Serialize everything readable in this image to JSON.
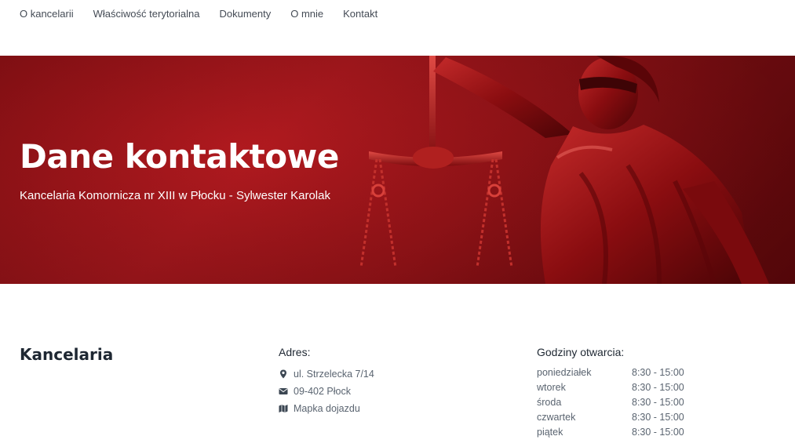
{
  "nav": {
    "items": [
      {
        "label": "O kancelarii"
      },
      {
        "label": "Właściwość terytorialna"
      },
      {
        "label": "Dokumenty"
      },
      {
        "label": "O mnie"
      },
      {
        "label": "Kontakt"
      }
    ]
  },
  "hero": {
    "title": "Dane kontaktowe",
    "subtitle": "Kancelaria Komornicza nr XIII w Płocku - Sylwester Karolak",
    "background_color": "#a3151b"
  },
  "office": {
    "title": "Kancelaria"
  },
  "address": {
    "heading": "Adres:",
    "street": {
      "icon": "map-marker-icon",
      "text": "ul. Strzelecka 7/14"
    },
    "city": {
      "icon": "envelope-icon",
      "text": "09-402 Płock"
    },
    "map": {
      "icon": "map-icon",
      "text": "Mapka dojazdu"
    }
  },
  "hours": {
    "heading": "Godziny otwarcia:",
    "rows": [
      {
        "day": "poniedziałek",
        "time": "8:30 - 15:00"
      },
      {
        "day": "wtorek",
        "time": "8:30 - 15:00"
      },
      {
        "day": "środa",
        "time": "8:30 - 15:00"
      },
      {
        "day": "czwartek",
        "time": "8:30 - 15:00"
      },
      {
        "day": "piątek",
        "time": "8:30 - 15:00"
      }
    ]
  }
}
